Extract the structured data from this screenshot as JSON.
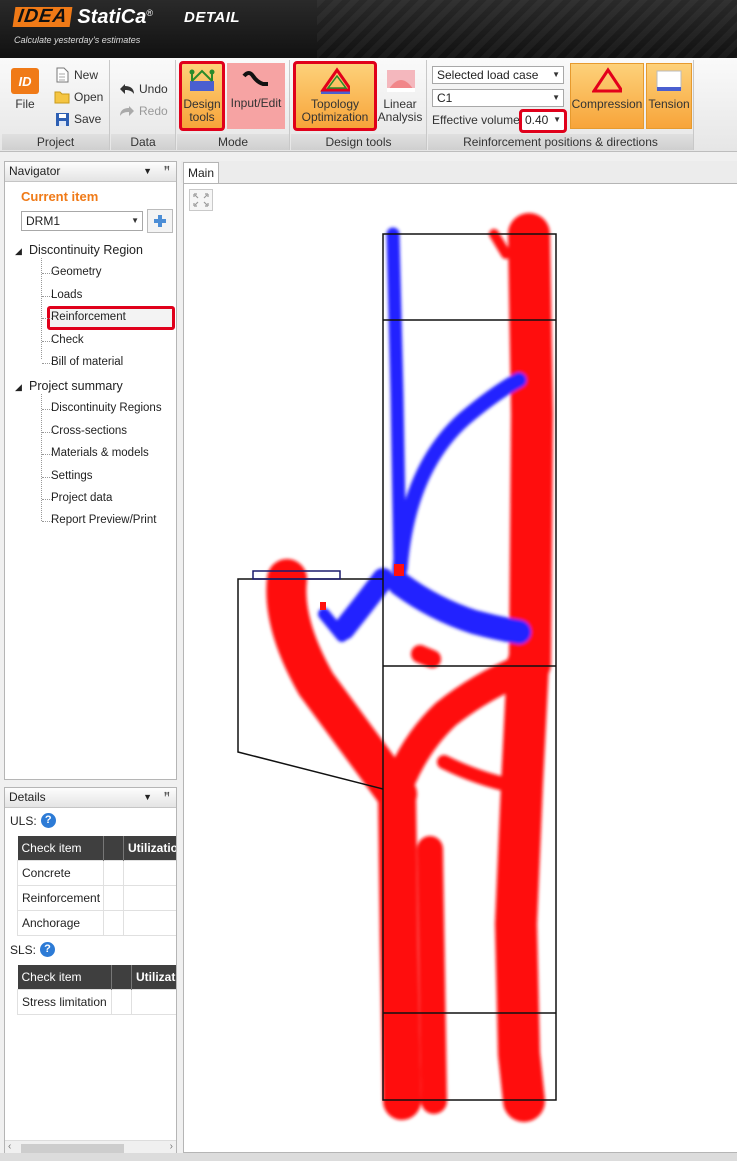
{
  "header": {
    "logo_text": "IDEA",
    "brand": "StatiCa",
    "registered": "®",
    "product": "DETAIL",
    "tagline": "Calculate yesterday's estimates"
  },
  "ribbon": {
    "project": {
      "label": "Project",
      "file": "File",
      "new": "New",
      "open": "Open",
      "save": "Save"
    },
    "data": {
      "label": "Data",
      "undo": "Undo",
      "redo": "Redo"
    },
    "mode": {
      "label": "Mode",
      "design_tools": "Design tools",
      "input_edit": "Input/Edit"
    },
    "design_tools": {
      "label": "Design tools",
      "topology": "Topology Optimization",
      "linear": "Linear Analysis"
    },
    "reinforcement": {
      "label": "Reinforcement positions & directions",
      "load_case_mode": "Selected load case",
      "load_case": "C1",
      "effective_volume_label": "Effective volume",
      "effective_volume_value": "0.40",
      "compression": "Compression",
      "tension": "Tension"
    }
  },
  "navigator": {
    "title": "Navigator",
    "current_item_label": "Current item",
    "current_item_value": "DRM1",
    "sections": [
      {
        "label": "Discontinuity Region",
        "items": [
          "Geometry",
          "Loads",
          "Reinforcement",
          "Check",
          "Bill of material"
        ]
      },
      {
        "label": "Project summary",
        "items": [
          "Discontinuity Regions",
          "Cross-sections",
          "Materials & models",
          "Settings",
          "Project data",
          "Report Preview/Print"
        ]
      }
    ],
    "selected_item": "Reinforcement"
  },
  "details": {
    "title": "Details",
    "uls_label": "ULS:",
    "sls_label": "SLS:",
    "uls_table": {
      "headers": [
        "Check item",
        "",
        "Utilizatio"
      ],
      "rows": [
        "Concrete",
        "Reinforcement",
        "Anchorage"
      ]
    },
    "sls_table": {
      "headers": [
        "Check item",
        "",
        "Utilizat"
      ],
      "rows": [
        "Stress limitation"
      ]
    }
  },
  "main": {
    "tab": "Main"
  },
  "colors": {
    "brand_orange": "#f07a17",
    "compression": "#ff0000",
    "tension": "#1a1aff",
    "highlight": "#e0001b",
    "active_button": "#f7a43a"
  }
}
